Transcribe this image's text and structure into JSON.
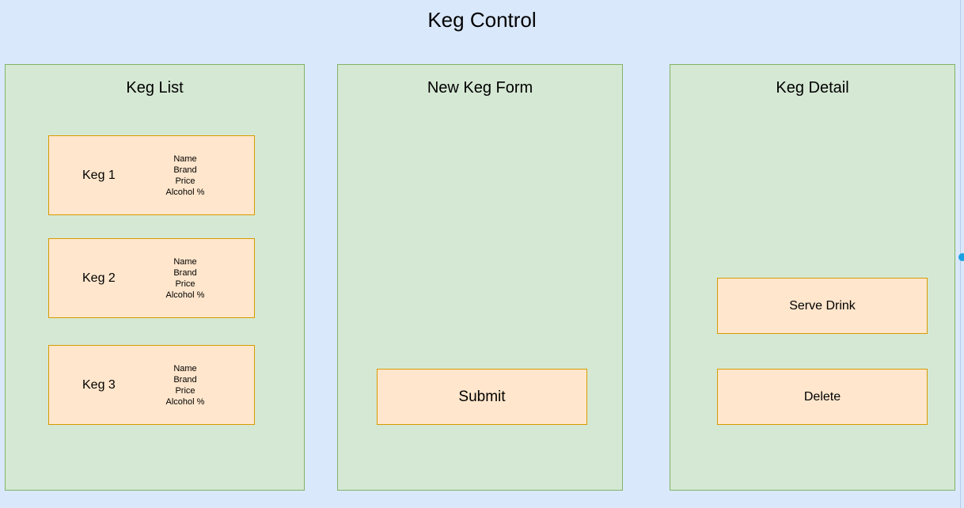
{
  "title": "Keg Control",
  "panels": {
    "list": {
      "title": "Keg List",
      "kegs": [
        {
          "name": "Keg 1",
          "fields": [
            "Name",
            "Brand",
            "Price",
            "Alcohol %"
          ]
        },
        {
          "name": "Keg 2",
          "fields": [
            "Name",
            "Brand",
            "Price",
            "Alcohol %"
          ]
        },
        {
          "name": "Keg 3",
          "fields": [
            "Name",
            "Brand",
            "Price",
            "Alcohol %"
          ]
        }
      ]
    },
    "form": {
      "title": "New Keg Form",
      "submit_label": "Submit"
    },
    "detail": {
      "title": "Keg Detail",
      "serve_label": "Serve Drink",
      "delete_label": "Delete"
    }
  },
  "colors": {
    "background": "#dae8fc",
    "panel_fill": "#d5e8d4",
    "panel_border": "#82b366",
    "box_fill": "#ffe6cc",
    "box_border": "#d79b00",
    "handle": "#1ba1e2"
  }
}
